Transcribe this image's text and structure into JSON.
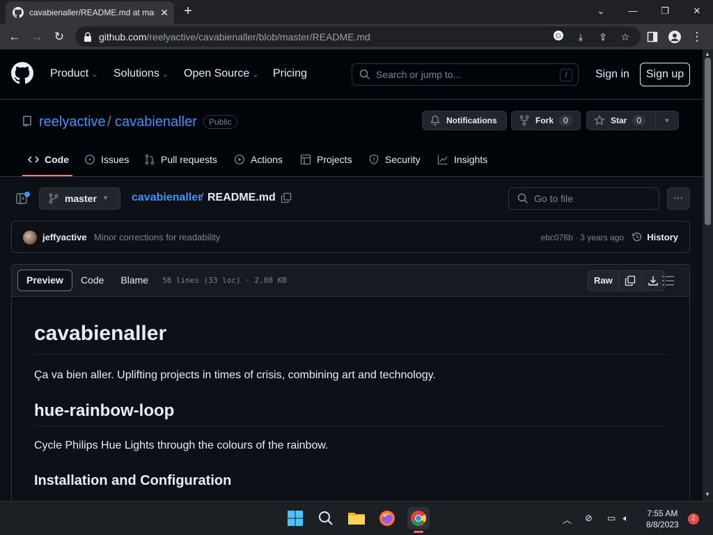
{
  "browser": {
    "tab_title": "cavabienaller/README.md at master",
    "url_domain": "github.com",
    "url_path": "/reelyactive/cavabienaller/blob/master/README.md"
  },
  "gh_nav": {
    "items": [
      "Product",
      "Solutions",
      "Open Source",
      "Pricing"
    ],
    "search_placeholder": "Search or jump to...",
    "search_shortcut": "/",
    "sign_in": "Sign in",
    "sign_up": "Sign up"
  },
  "repo": {
    "owner": "reelyactive",
    "separator": "/",
    "name": "cavabienaller",
    "visibility": "Public",
    "notifications_label": "Notifications",
    "fork_label": "Fork",
    "fork_count": "0",
    "star_label": "Star",
    "star_count": "0",
    "tabs": [
      "Code",
      "Issues",
      "Pull requests",
      "Actions",
      "Projects",
      "Security",
      "Insights"
    ]
  },
  "file_bar": {
    "branch": "master",
    "crumb_repo": "cavabienaller",
    "crumb_sep": "/",
    "crumb_file": "README.md",
    "goto_placeholder": "Go to file"
  },
  "commit": {
    "user": "jeffyactive",
    "message": "Minor corrections for readability",
    "meta": "ebc076b · 3 years ago",
    "history_label": "History"
  },
  "file_view": {
    "tabs": [
      "Preview",
      "Code",
      "Blame"
    ],
    "info": "58 lines (33 loc) · 2.08 KB",
    "raw_label": "Raw"
  },
  "readme": {
    "h1": "cavabienaller",
    "p1": "Ça va bien aller. Uplifting projects in times of crisis, combining art and technology.",
    "h2": "hue-rainbow-loop",
    "p2": "Cycle Philips Hue Lights through the colours of the rainbow.",
    "h3": "Installation and Configuration"
  },
  "taskbar": {
    "time": "7:55 AM",
    "date": "8/8/2023",
    "notifications": "2"
  },
  "colors": {
    "accent_link": "#4493f8",
    "tab_underline": "#f78166",
    "bg": "#0d1117"
  }
}
